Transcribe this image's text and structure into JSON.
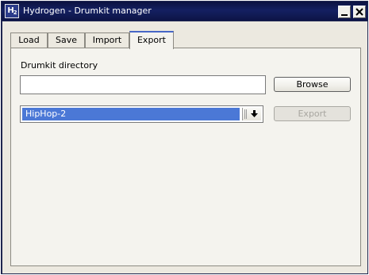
{
  "window": {
    "title": "Hydrogen - Drumkit manager",
    "icon_name": "hydrogen-app-icon",
    "icon_text": "H",
    "icon_sub": "2"
  },
  "tabs": [
    {
      "label": "Load",
      "active": false
    },
    {
      "label": "Save",
      "active": false
    },
    {
      "label": "Import",
      "active": false
    },
    {
      "label": "Export",
      "active": true
    }
  ],
  "export_panel": {
    "directory_label": "Drumkit directory",
    "directory_value": "",
    "browse_label": "Browse",
    "drumkit_selected": "HipHop-2",
    "export_label": "Export",
    "export_enabled": false
  },
  "colors": {
    "titlebar": "#142061",
    "selection": "#4b78d6",
    "active_tab_accent": "#4766c7",
    "window_bg": "#ece9e0"
  }
}
